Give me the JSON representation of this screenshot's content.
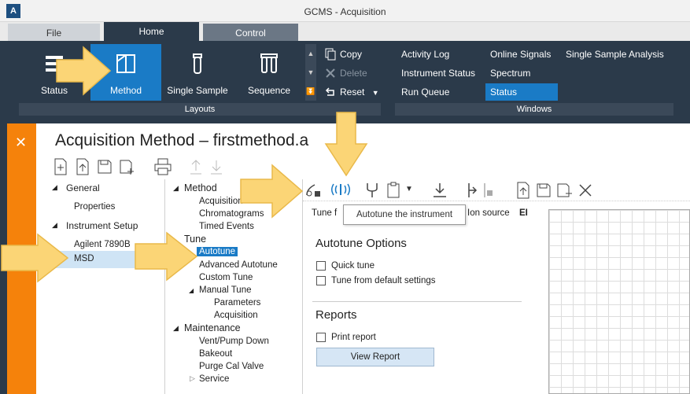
{
  "app": {
    "logo": "A",
    "title": "GCMS - Acquisition"
  },
  "tabs": {
    "file": "File",
    "home": "Home",
    "control": "Control"
  },
  "layouts": {
    "status": "Status",
    "method": "Method",
    "single_sample": "Single Sample",
    "sequence": "Sequence",
    "group_label": "Layouts"
  },
  "edit": {
    "copy": "Copy",
    "delete": "Delete",
    "reset": "Reset"
  },
  "windows": {
    "activity_log": "Activity Log",
    "instrument_status": "Instrument Status",
    "run_queue": "Run Queue",
    "online_signals": "Online Signals",
    "spectrum": "Spectrum",
    "status": "Status",
    "single_sample_analysis": "Single Sample Analysis",
    "group_label": "Windows"
  },
  "main": {
    "title": "Acquisition Method – firstmethod.a"
  },
  "tree1": {
    "general": "General",
    "properties": "Properties",
    "instrument_setup": "Instrument Setup",
    "agilent": "Agilent 7890B",
    "msd": "MSD"
  },
  "tree2": {
    "method": "Method",
    "acquisition": "Acquisition",
    "chromatograms": "Chromatograms",
    "timed_events": "Timed Events",
    "tune": "Tune",
    "autotune": "Autotune",
    "advanced_autotune": "Advanced Autotune",
    "custom_tune": "Custom Tune",
    "manual_tune": "Manual Tune",
    "parameters": "Parameters",
    "acquisition2": "Acquisition",
    "maintenance": "Maintenance",
    "vent_pump": "Vent/Pump Down",
    "bakeout": "Bakeout",
    "purge": "Purge Cal Valve",
    "service": "Service"
  },
  "panel": {
    "tune_label": "Tune f",
    "ion_source_label": "Ion source",
    "ion_source_value": "EI",
    "tooltip": "Autotune the instrument",
    "autotune_options": "Autotune Options",
    "quick_tune": "Quick tune",
    "tune_default": "Tune from default settings",
    "reports": "Reports",
    "print_report": "Print report",
    "view_report": "View Report"
  },
  "colors": {
    "accent": "#1a7bc6",
    "orange": "#f5820b",
    "arrow": "#fbd576",
    "ribbon": "#2b3a4a"
  }
}
